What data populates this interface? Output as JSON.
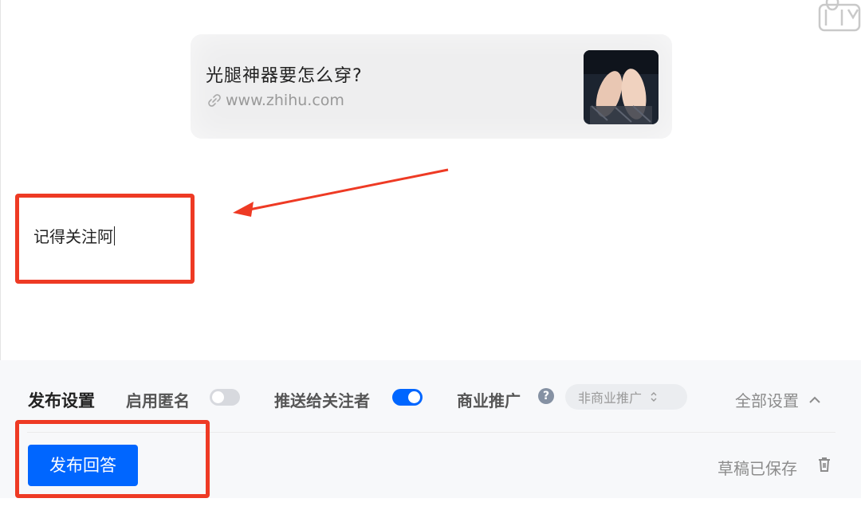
{
  "link_card": {
    "title": "光腿神器要怎么穿?",
    "url": "www.zhihu.com"
  },
  "editor": {
    "answer_text": "记得关注阿"
  },
  "settings": {
    "title": "发布设置",
    "anonymous_label": "启用匿名",
    "anonymous_enabled": false,
    "push_label": "推送给关注者",
    "push_enabled": true,
    "commercial_label": "商业推广",
    "commercial_select_value": "非商业推广",
    "all_settings_label": "全部设置"
  },
  "footer": {
    "publish_label": "发布回答",
    "draft_status": "草稿已保存"
  },
  "colors": {
    "accent": "#0066ff",
    "annotation": "#ee3a24"
  },
  "icons": [
    "link-icon",
    "help-icon",
    "select-caret-icon",
    "chevron-up-icon",
    "trash-icon",
    "iqiyi-logo"
  ]
}
